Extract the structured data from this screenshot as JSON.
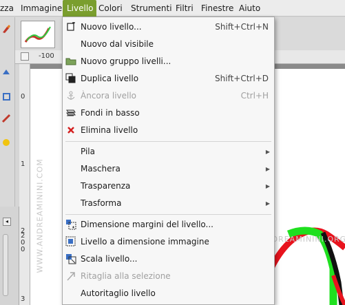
{
  "menubar": {
    "items": [
      "zza",
      "Immagine",
      "Livello",
      "Colori",
      "Strumenti",
      "Filtri",
      "Finestre",
      "Aiuto"
    ],
    "active": "Livello"
  },
  "ruler": {
    "h_label": "-100",
    "v_labels": [
      "0",
      "1",
      "2",
      "2\n0\n0",
      "3"
    ]
  },
  "watermark": {
    "horizontal": "WWW.ANDREAMININI.ORG",
    "vertical": "WWW.ANDREAMININI.COM"
  },
  "menu": {
    "items": [
      {
        "label": "Nuovo livello...",
        "shortcut": "Shift+Ctrl+N",
        "icon": "new-layer-icon",
        "disabled": false
      },
      {
        "label": "Nuovo dal visibile",
        "shortcut": "",
        "icon": "",
        "disabled": false
      },
      {
        "label": "Nuovo gruppo livelli...",
        "shortcut": "",
        "icon": "folder-icon",
        "disabled": false
      },
      {
        "label": "Duplica livello",
        "shortcut": "Shift+Ctrl+D",
        "icon": "duplicate-icon",
        "disabled": false
      },
      {
        "label": "Àncora livello",
        "shortcut": "Ctrl+H",
        "icon": "anchor-icon",
        "disabled": true
      },
      {
        "label": "Fondi in basso",
        "shortcut": "",
        "icon": "merge-down-icon",
        "disabled": false
      },
      {
        "label": "Elimina livello",
        "shortcut": "",
        "icon": "delete-icon",
        "disabled": false
      },
      {
        "label": "Pila",
        "submenu": true
      },
      {
        "label": "Maschera",
        "submenu": true
      },
      {
        "label": "Trasparenza",
        "submenu": true
      },
      {
        "label": "Trasforma",
        "submenu": true
      },
      {
        "label": "Dimensione margini del livello...",
        "shortcut": "",
        "icon": "layer-boundary-icon",
        "disabled": false
      },
      {
        "label": "Livello a dimensione immagine",
        "shortcut": "",
        "icon": "layer-to-image-icon",
        "disabled": false
      },
      {
        "label": "Scala livello...",
        "shortcut": "",
        "icon": "scale-layer-icon",
        "disabled": false
      },
      {
        "label": "Ritaglia alla selezione",
        "shortcut": "",
        "icon": "crop-icon",
        "disabled": true
      },
      {
        "label": "Autoritaglio livello",
        "shortcut": "",
        "icon": "",
        "disabled": false
      }
    ]
  },
  "colors": {
    "menu_active": "#7a9e2e",
    "stroke_red": "#e8141e",
    "stroke_green": "#1fe01f",
    "stroke_black": "#111111",
    "delete_red": "#d42020"
  }
}
